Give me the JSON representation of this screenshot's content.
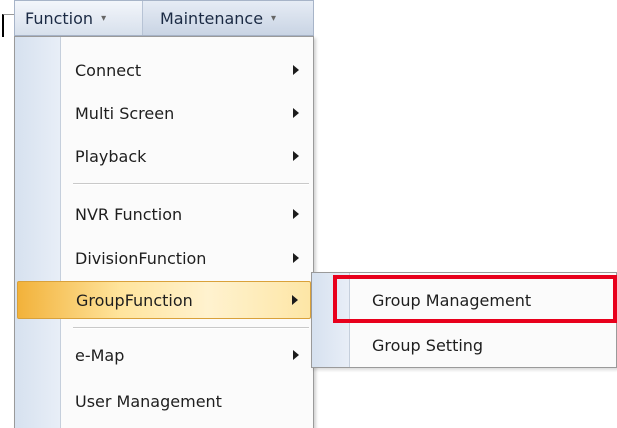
{
  "menubar": {
    "items": [
      {
        "label": "Function",
        "caret": "▾"
      },
      {
        "label": "Maintenance",
        "caret": "▾"
      }
    ]
  },
  "function_menu": {
    "items": [
      {
        "label": "Connect",
        "has_submenu": true
      },
      {
        "label": "Multi Screen",
        "has_submenu": true
      },
      {
        "label": "Playback",
        "has_submenu": true
      },
      {
        "label": "NVR Function",
        "has_submenu": true
      },
      {
        "label": "DivisionFunction",
        "has_submenu": true
      },
      {
        "label": "GroupFunction",
        "has_submenu": true,
        "highlighted": true
      },
      {
        "label": "e-Map",
        "has_submenu": true
      },
      {
        "label": "User Management",
        "has_submenu": false
      }
    ]
  },
  "group_submenu": {
    "items": [
      {
        "label": "Group Management",
        "marked": true
      },
      {
        "label": "Group Setting"
      }
    ]
  },
  "colors": {
    "highlight_start": "#f2b23b",
    "highlight_end": "#fff2cf",
    "focus_outline": "#e8001c",
    "gutter": "#d6e1ef"
  }
}
